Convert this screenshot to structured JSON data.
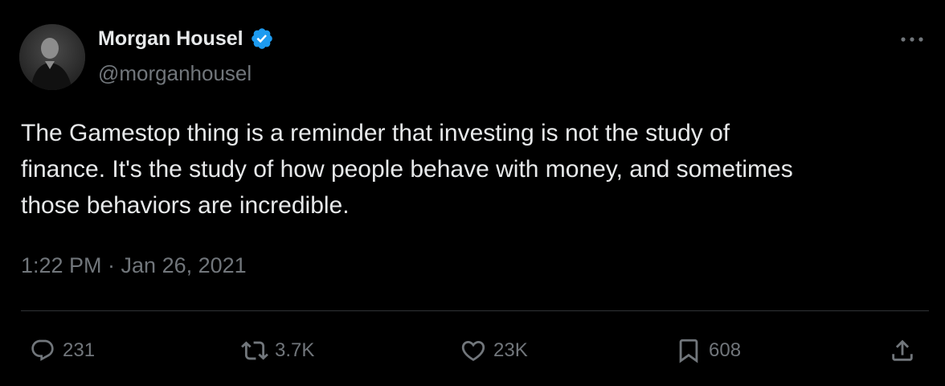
{
  "author": {
    "name": "Morgan Housel",
    "handle": "@morganhousel",
    "verified": true
  },
  "tweet": {
    "text": "The Gamestop thing is a reminder that investing is not the study of\nfinance. It's the study of how people behave with money, and sometimes\nthose behaviors are incredible.",
    "timestamp": "1:22 PM · Jan 26, 2021"
  },
  "actions": {
    "replies": "231",
    "retweets": "3.7K",
    "likes": "23K",
    "bookmarks": "608"
  },
  "icons": {
    "reply": "reply-icon",
    "retweet": "retweet-icon",
    "like": "heart-icon",
    "bookmark": "bookmark-icon",
    "share": "share-icon",
    "more": "more-dots-icon",
    "verified": "verified-badge-icon"
  },
  "colors": {
    "background": "#000000",
    "primary_text": "#e7e9ea",
    "secondary_text": "#71767b",
    "divider": "#2f3336",
    "verified_blue": "#1d9bf0"
  }
}
